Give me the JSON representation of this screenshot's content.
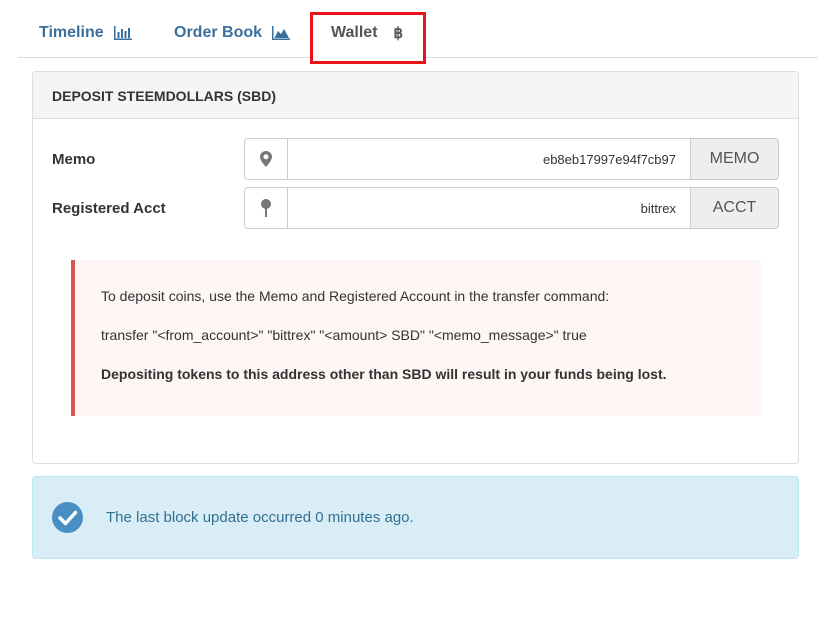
{
  "tabs": {
    "timeline": {
      "label": "Timeline",
      "icon": "bar-chart-icon"
    },
    "order_book": {
      "label": "Order Book",
      "icon": "area-chart-icon"
    },
    "wallet": {
      "label": "Wallet",
      "icon": "bitcoin-icon",
      "icon_glyph": "฿"
    }
  },
  "panel": {
    "heading": "DEPOSIT STEEMDOLLARS (SBD)",
    "memo": {
      "label": "Memo",
      "value": "eb8eb17997e94f7cb97",
      "addon": "MEMO",
      "icon": "map-marker-icon"
    },
    "account": {
      "label": "Registered Acct",
      "value": "bittrex",
      "addon": "ACCT",
      "icon": "pushpin-icon"
    },
    "instructions": {
      "line1": "To deposit coins, use the Memo and Registered Account in the transfer command:",
      "line2": "transfer \"<from_account>\" \"bittrex\" \"<amount> SBD\" \"<memo_message>\" true",
      "warning": "Depositing tokens to this address other than SBD will result in your funds being lost."
    }
  },
  "alert": {
    "message": "The last block update occurred 0 minutes ago.",
    "icon": "check-circle-icon"
  },
  "colors": {
    "link": "#3b6f9e",
    "highlight_border": "#e8141a",
    "callout_border": "#d9534f",
    "alert_bg": "#d9edf7",
    "alert_text": "#31708f",
    "check": "#4a8fc4"
  }
}
